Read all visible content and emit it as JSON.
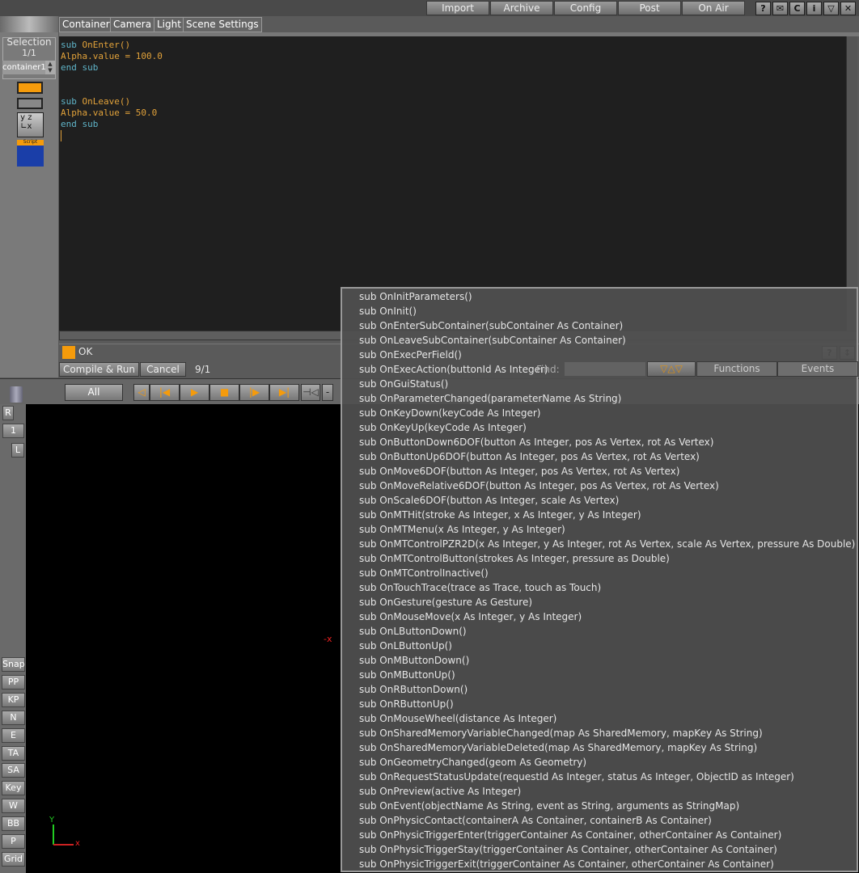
{
  "topbar": {
    "buttons": [
      "Import",
      "Archive",
      "Config",
      "Post",
      "On Air"
    ],
    "icons": [
      "help-icon",
      "mail-icon",
      "console-icon",
      "info-icon",
      "dropdown-icon",
      "close-icon"
    ]
  },
  "tabs": [
    "Container",
    "Camera",
    "Light",
    "Scene Settings"
  ],
  "selection": {
    "title": "Selection",
    "count": "1/1",
    "value": "container1",
    "script_thumb": "Script"
  },
  "editor": {
    "lines": [
      [
        {
          "t": "sub ",
          "c": "kw"
        },
        {
          "t": "OnEnter()",
          "c": "fn"
        }
      ],
      [
        {
          "t": "Alpha.value = 100.0",
          "c": "fn"
        }
      ],
      [
        {
          "t": "end sub",
          "c": "kw"
        }
      ],
      [],
      [],
      [
        {
          "t": "sub ",
          "c": "kw"
        },
        {
          "t": "OnLeave()",
          "c": "fn"
        }
      ],
      [
        {
          "t": "Alpha.value = 50.0",
          "c": "fn"
        }
      ],
      [
        {
          "t": "end sub",
          "c": "kw"
        }
      ]
    ]
  },
  "status": {
    "message": "OK"
  },
  "actions": {
    "compile": "Compile & Run",
    "cancel": "Cancel",
    "position": "9/1",
    "find_label": "Find:",
    "find_value": "",
    "functions": "Functions",
    "events": "Events"
  },
  "toolbar": {
    "all": "All"
  },
  "sidebar": [
    "Snap",
    "PP",
    "KP",
    "N",
    "E",
    "TA",
    "SA",
    "Key",
    "W",
    "BB",
    "P",
    "Grid"
  ],
  "sidebar_top": {
    "r": "R",
    "one": "1",
    "l": "L"
  },
  "axes": {
    "x": "x",
    "y": "Y",
    "neg_x": "-x"
  },
  "colors": {
    "accent": "#f59b0b",
    "keyword": "#5fb4c8",
    "function": "#e2a23a"
  },
  "popup": [
    "sub OnInitParameters()",
    "sub OnInit()",
    "sub OnEnterSubContainer(subContainer As Container)",
    "sub OnLeaveSubContainer(subContainer As Container)",
    "sub OnExecPerField()",
    "sub OnExecAction(buttonId As Integer)",
    "sub OnGuiStatus()",
    "sub OnParameterChanged(parameterName As String)",
    "sub OnKeyDown(keyCode As Integer)",
    "sub OnKeyUp(keyCode As Integer)",
    "sub OnButtonDown6DOF(button As Integer, pos As Vertex, rot As Vertex)",
    "sub OnButtonUp6DOF(button As Integer, pos As Vertex, rot As Vertex)",
    "sub OnMove6DOF(button As Integer, pos As Vertex, rot As Vertex)",
    "sub OnMoveRelative6DOF(button As Integer, pos As Vertex, rot As Vertex)",
    "sub OnScale6DOF(button As Integer, scale As Vertex)",
    "sub OnMTHit(stroke As Integer, x As Integer, y As Integer)",
    "sub OnMTMenu(x As Integer, y As Integer)",
    "sub OnMTControlPZR2D(x As Integer, y As Integer, rot As Vertex, scale As Vertex, pressure As Double)",
    "sub OnMTControlButton(strokes As Integer, pressure as Double)",
    "sub OnMTControlInactive()",
    "sub OnTouchTrace(trace as Trace, touch as Touch)",
    "sub OnGesture(gesture As Gesture)",
    "sub OnMouseMove(x As Integer, y As Integer)",
    "sub OnLButtonDown()",
    "sub OnLButtonUp()",
    "sub OnMButtonDown()",
    "sub OnMButtonUp()",
    "sub OnRButtonDown()",
    "sub OnRButtonUp()",
    "sub OnMouseWheel(distance As Integer)",
    "sub OnSharedMemoryVariableChanged(map As SharedMemory, mapKey As String)",
    "sub OnSharedMemoryVariableDeleted(map As SharedMemory, mapKey As String)",
    "sub OnGeometryChanged(geom As Geometry)",
    "sub OnRequestStatusUpdate(requestId As Integer, status As Integer, ObjectID as Integer)",
    "sub OnPreview(active As Integer)",
    "sub OnEvent(objectName As String, event as String, arguments as StringMap)",
    "sub OnPhysicContact(containerA As Container, containerB As Container)",
    "sub OnPhysicTriggerEnter(triggerContainer As Container, otherContainer As Container)",
    "sub OnPhysicTriggerStay(triggerContainer As Container, otherContainer As Container)",
    "sub OnPhysicTriggerExit(triggerContainer As Container, otherContainer As Container)"
  ]
}
